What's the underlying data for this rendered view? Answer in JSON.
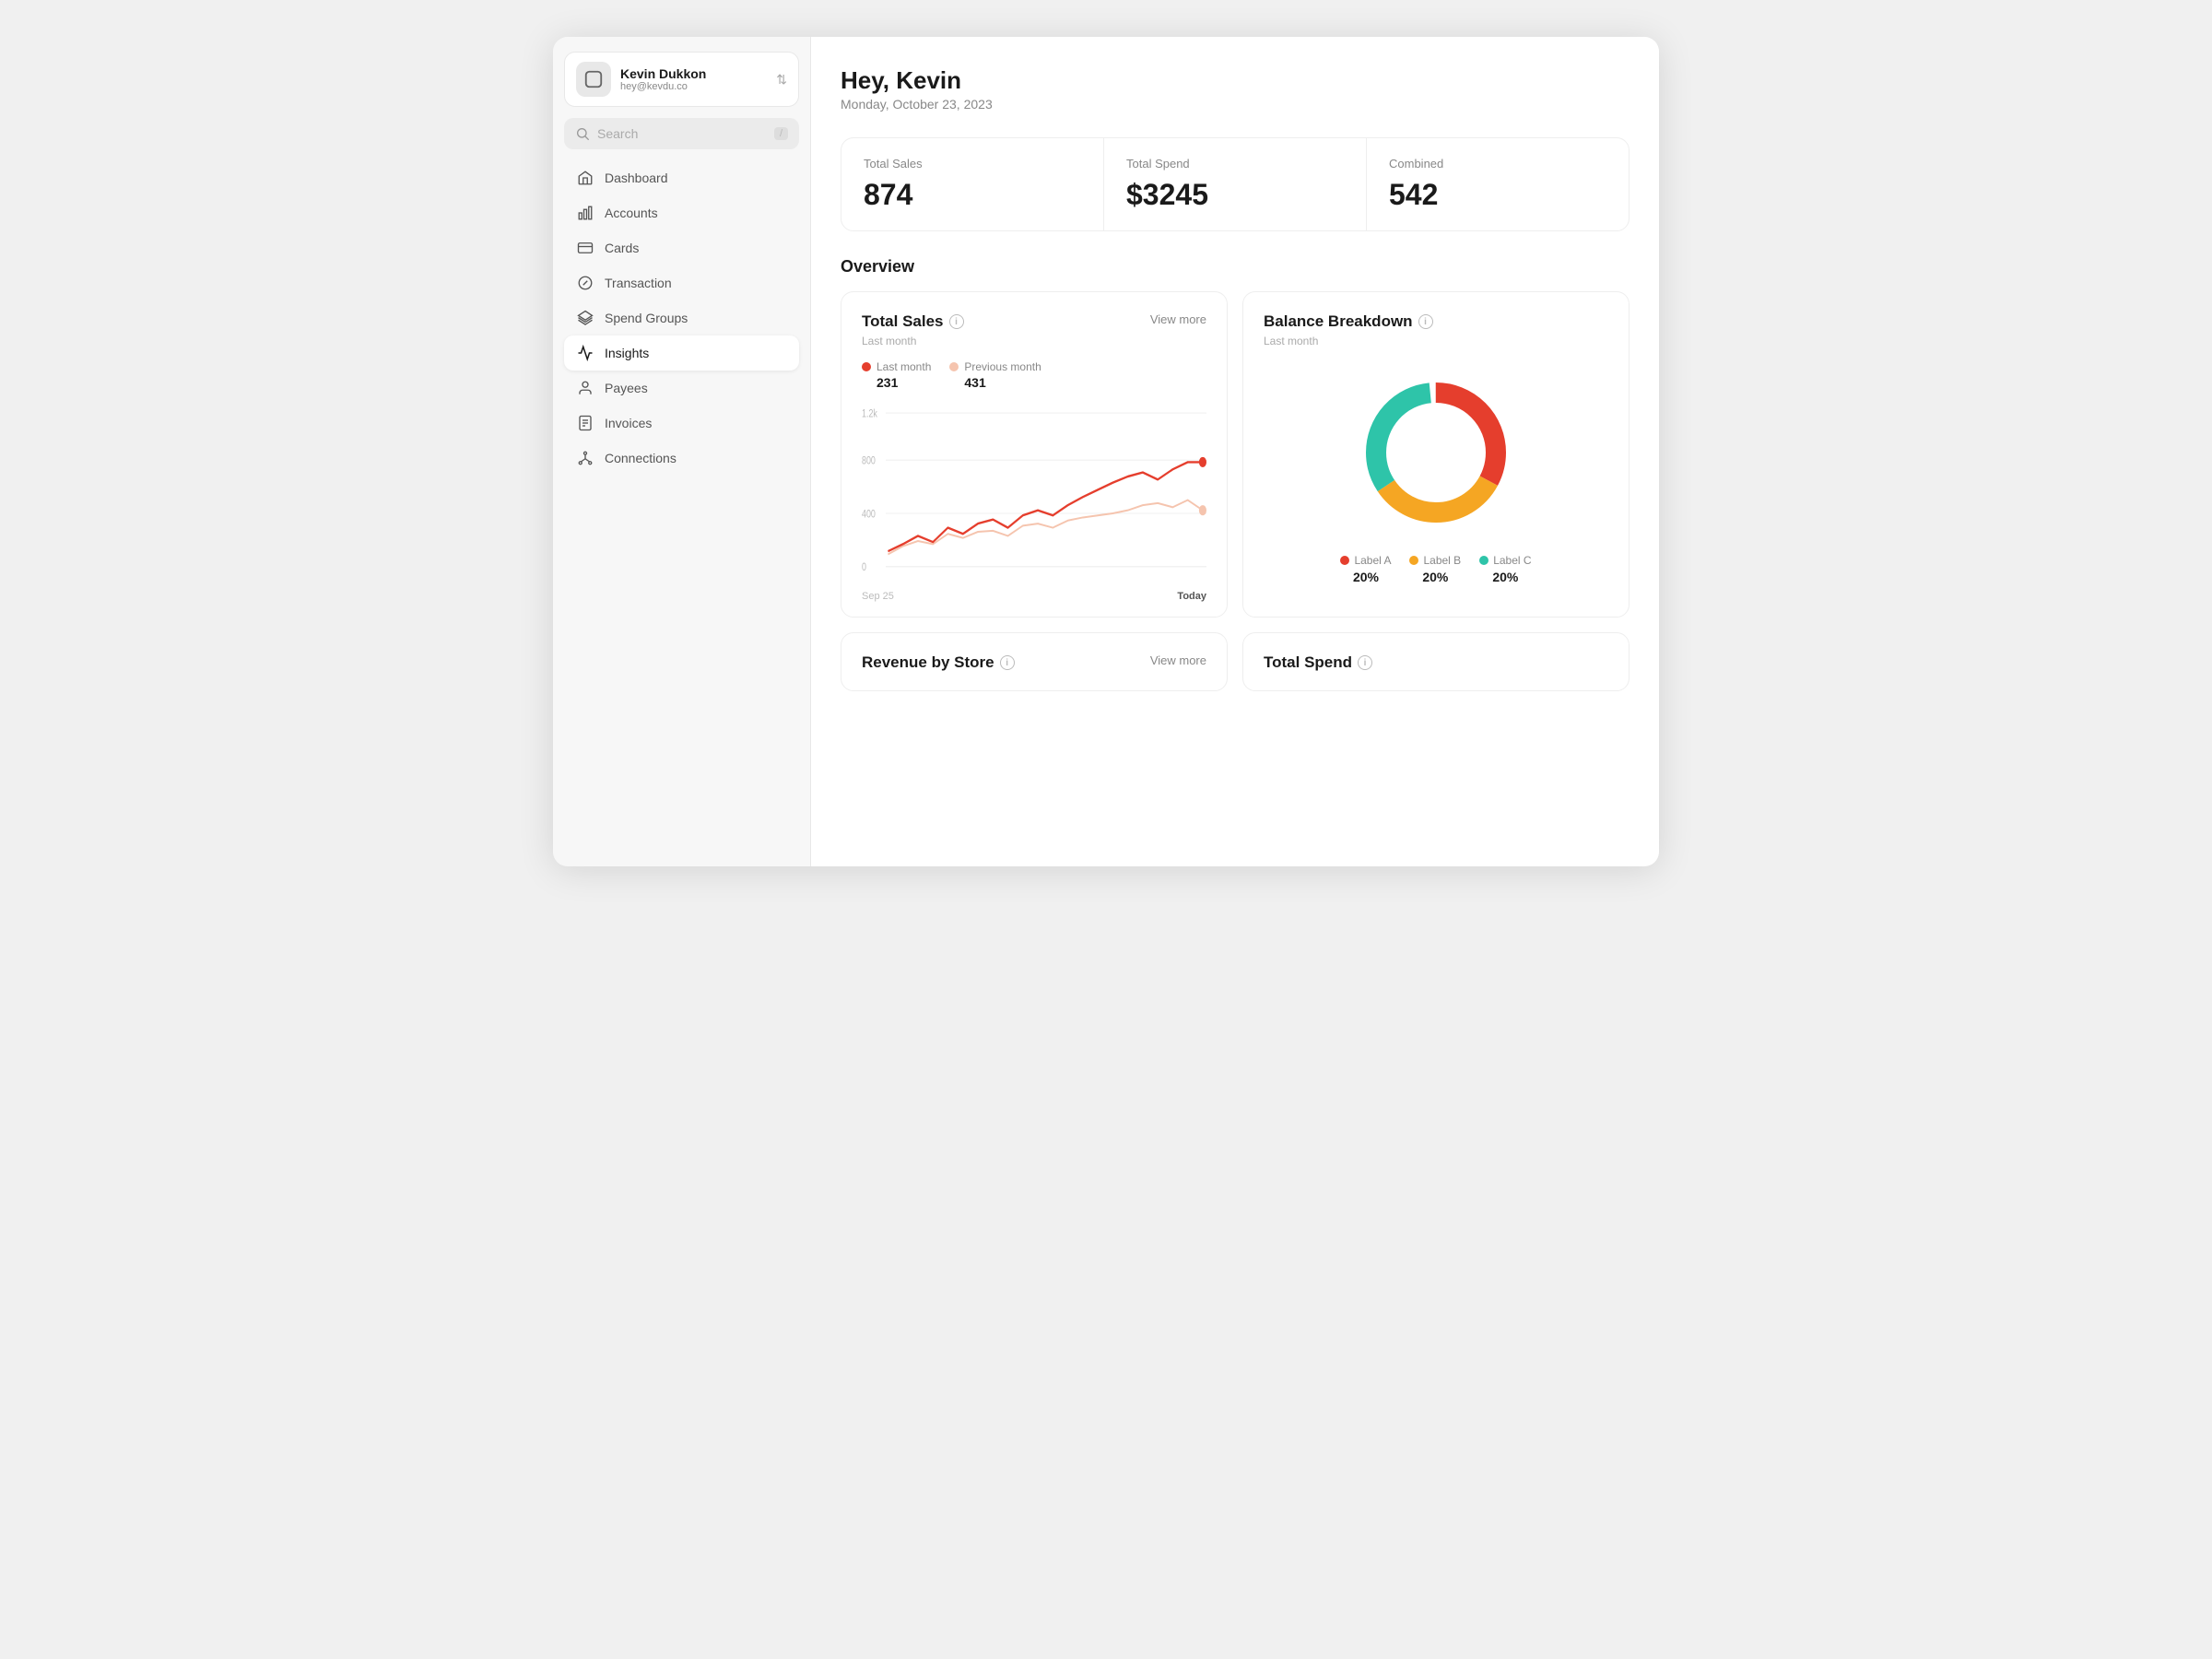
{
  "user": {
    "name": "Kevin Dukkon",
    "email": "hey@kevdu.co"
  },
  "search": {
    "placeholder": "Search",
    "shortcut": "/"
  },
  "nav": {
    "items": [
      {
        "id": "dashboard",
        "label": "Dashboard",
        "icon": "home"
      },
      {
        "id": "accounts",
        "label": "Accounts",
        "icon": "bar-chart"
      },
      {
        "id": "cards",
        "label": "Cards",
        "icon": "credit-card"
      },
      {
        "id": "transaction",
        "label": "Transaction",
        "icon": "camera"
      },
      {
        "id": "spend-groups",
        "label": "Spend Groups",
        "icon": "layers"
      },
      {
        "id": "insights",
        "label": "Insights",
        "icon": "activity",
        "active": true
      },
      {
        "id": "payees",
        "label": "Payees",
        "icon": "user"
      },
      {
        "id": "invoices",
        "label": "Invoices",
        "icon": "file-text"
      },
      {
        "id": "connections",
        "label": "Connections",
        "icon": "git-branch"
      }
    ]
  },
  "header": {
    "greeting": "Hey, Kevin",
    "date": "Monday, October 23, 2023"
  },
  "stats": [
    {
      "label": "Total Sales",
      "value": "874"
    },
    {
      "label": "Total Spend",
      "value": "$3245"
    },
    {
      "label": "Combined",
      "value": "542"
    }
  ],
  "overview_title": "Overview",
  "total_sales_chart": {
    "title": "Total Sales",
    "subtitle": "Last month",
    "view_more": "View more",
    "legend": [
      {
        "label": "Last month",
        "value": "231",
        "color": "#e53e2d"
      },
      {
        "label": "Previous month",
        "value": "431",
        "color": "#f5c4ae"
      }
    ],
    "y_labels": [
      "1.2k",
      "800",
      "400",
      "0"
    ],
    "x_start": "Sep 25",
    "x_end": "Today"
  },
  "balance_breakdown": {
    "title": "Balance Breakdown",
    "subtitle": "Last month",
    "segments": [
      {
        "label": "Label A",
        "pct": "20%",
        "color": "#e53e2d"
      },
      {
        "label": "Label B",
        "pct": "20%",
        "color": "#f5a623"
      },
      {
        "label": "Label C",
        "pct": "20%",
        "color": "#2ec4a9"
      }
    ]
  },
  "revenue_by_store": {
    "title": "Revenue by Store",
    "view_more": "View more"
  },
  "total_spend": {
    "title": "Total Spend"
  }
}
